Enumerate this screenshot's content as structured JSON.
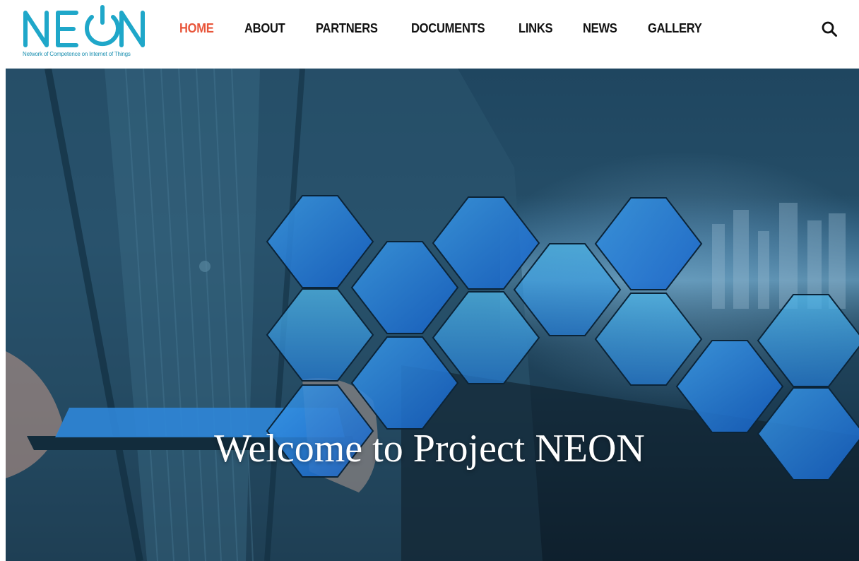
{
  "header": {
    "logo": {
      "text": "NEON",
      "tagline": "Network of Competence on Internet of Things",
      "color": "#1fa7c9"
    },
    "nav": [
      {
        "label": "HOME",
        "active": true
      },
      {
        "label": "ABOUT",
        "active": false
      },
      {
        "label": "PARTNERS",
        "active": false
      },
      {
        "label": "DOCUMENTS",
        "active": false
      },
      {
        "label": "LINKS",
        "active": false
      },
      {
        "label": "NEWS",
        "active": false
      },
      {
        "label": "GALLERY",
        "active": false
      }
    ],
    "search_icon": "search-icon"
  },
  "hero": {
    "title": "Welcome to Project NEON"
  },
  "colors": {
    "accent": "#e8553a",
    "nav_text": "#111111",
    "brand": "#1fa7c9",
    "hero_dark": "#1d3f56"
  }
}
